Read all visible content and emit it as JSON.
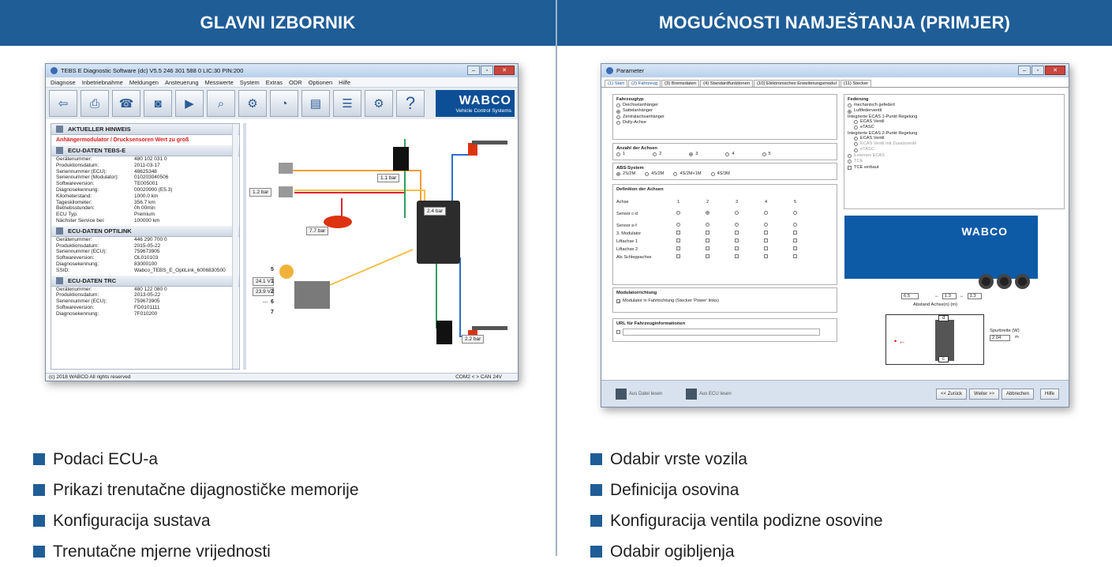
{
  "left": {
    "header": "GLAVNI IZBORNIK",
    "bullets": [
      "Podaci ECU-a",
      "Prikazi trenutačne dijagnostičke memorije",
      "Konfiguracija sustava",
      "Trenutačne mjerne vrijednosti"
    ],
    "window": {
      "title": "TEBS E Diagnostic Software (dc) V5.5   246 301 588 0  LIC:30 PIN:200",
      "menu": [
        "Diagnose",
        "Inbetriebnahme",
        "Meldungen",
        "Ansteuerung",
        "Messwerte",
        "System",
        "Extras",
        "ODR",
        "Optionen",
        "Hilfe"
      ],
      "toolbar_icons": [
        "exit-icon",
        "printer-icon",
        "fax-icon",
        "ecu-icon",
        "play-icon",
        "magnifier-icon",
        "engine-icon",
        "gauge-icon",
        "meter-icon",
        "sliders-icon",
        "ecu-gear-icon",
        "help-icon"
      ],
      "wabco": "WABCO",
      "wabco_sub": "Vehicle Control Systems",
      "hint_title": "AKTUELLER HINWEIS",
      "hint_text": "Anhängermodulator / Drucksensoren Wert zu groß",
      "sec1": "ECU-DATEN TEBS-E",
      "rows1": [
        [
          "Gerätenummer:",
          "480 102 031 0"
        ],
        [
          "Produktionsdatum:",
          "2011-03-17"
        ],
        [
          "Seriennummer (ECU):",
          "48625348"
        ],
        [
          "Seriennummer (Modulator):",
          "010203040506"
        ],
        [
          "Softwareversion:",
          "TE005001"
        ],
        [
          "Diagnosekennung:",
          "00020900 (E5.3)"
        ],
        [
          "Kilometerstand:",
          "1000.0 km"
        ],
        [
          "Tageskilometer:",
          "356.7 km"
        ],
        [
          "Betriebsstunden:",
          "0h 00min"
        ],
        [
          "ECU Typ:",
          "Premium"
        ],
        [
          "Nächster Service bei:",
          "100000 km"
        ]
      ],
      "sec2": "ECU-DATEN OPTILINK",
      "rows2": [
        [
          "Gerätenummer:",
          "446 290 700 0"
        ],
        [
          "Produktionsdatum:",
          "2015-05-22"
        ],
        [
          "Seriennummer (ECU):",
          "759673905"
        ],
        [
          "Softwareversion:",
          "OL010103"
        ],
        [
          "Diagnosekennung:",
          "83000100"
        ],
        [
          "SSID:",
          "Wabco_TEBS_E_OptiLink_6006830500"
        ]
      ],
      "sec3": "ECU-DATEN TRC",
      "rows3": [
        [
          "Gerätenummer:",
          "480 122 080 0"
        ],
        [
          "Produktionsdatum:",
          "2013-05-22"
        ],
        [
          "Seriennummer (ECU):",
          "759673905"
        ],
        [
          "Softwareversion:",
          "FD0101111"
        ],
        [
          "Diagnosekennung:",
          "7F010200"
        ]
      ],
      "status": "(c) 2018 WABCO All rights reserved",
      "status_right": "COM2 < > CAN 24V",
      "pressures": [
        "2.4 bar",
        "1.1 bar",
        "1.2 bar",
        "7.7 bar",
        "2.2 bar"
      ],
      "voltages": [
        "24.1 V",
        "23.9 V",
        "---"
      ],
      "pins": [
        "5",
        "1",
        "2",
        "6",
        "7"
      ]
    }
  },
  "right": {
    "header": "MOGUĆNOSTI NAMJEŠTANJA (PRIMJER)",
    "bullets": [
      "Odabir vrste vozila",
      "Definicija osovina",
      "Konfiguracija ventila podizne osovine",
      "Odabir ogibljenja"
    ],
    "window": {
      "title": "Parameter",
      "tabs": [
        "(1) Start",
        "(2) Fahrzeug",
        "(3) Bremsdaten",
        "(4) Standardfunktionen",
        "(10) Elektronisches Erweiterungsmodul",
        "(11) Stecker"
      ],
      "fahrzeugtyp": {
        "title": "Fahrzeugtyp",
        "opts": [
          "Deichselanhänger",
          "Sattelanhänger",
          "Zentralachsanhänger",
          "Dolly-Achse"
        ]
      },
      "achsen": {
        "title": "Anzahl der Achsen",
        "opts": [
          "1",
          "2",
          "3",
          "4",
          "5"
        ]
      },
      "abs": {
        "title": "ABS-System",
        "opts": [
          "2S/2M",
          "4S/2M",
          "4S/2M+1M",
          "4S/3M"
        ]
      },
      "def": {
        "title": "Definition der Achsen",
        "cols": [
          "Achse",
          "1",
          "2",
          "3",
          "4",
          "5"
        ],
        "rows": [
          "Sensor c-d",
          "Sensor e-f",
          "3. Modulator",
          "Liftachse 1",
          "Liftachse 2",
          "Als Schleppachse"
        ]
      },
      "modulator": {
        "title": "Modulatorrichtung",
        "text": "Modulator in Fahrtrichtung (Stecker 'Power' links)"
      },
      "url": {
        "title": "URL für Fahrzeuginformationen"
      },
      "federung": {
        "title": "Federung",
        "opts": [
          "mechanisch gefedert",
          "Luftfederventil"
        ],
        "sub1": "Integrierte ECAS 1-Punkt Regelung",
        "sub1opts": [
          "ECAS Ventil",
          "eTASC"
        ],
        "sub2": "Integrierte ECAS 2-Punkt Regelung",
        "sub2opts": [
          "ECAS Ventil",
          "ECAS Ventil mit Zusatzventil",
          "eTASC"
        ],
        "more": [
          "Externes ECAS",
          "TCE",
          "TCE verbaut"
        ]
      },
      "trailer_brand": "WABCO",
      "dims": {
        "a": "6.5",
        "b": "1.3",
        "c": "1.3",
        "caption": "Abstand Achse(n) (m)",
        "spur": "Spurbreite (W)",
        "spur_val": "2.04",
        "spur_unit": "m",
        "d": "d",
        "c2": "c"
      },
      "buttons": [
        "<< Zurück",
        "Weiter >>",
        "Abbrechen",
        "Hilfe"
      ],
      "file_buttons": [
        "Aus Datei lesen",
        "Aus ECU lesen"
      ]
    }
  }
}
